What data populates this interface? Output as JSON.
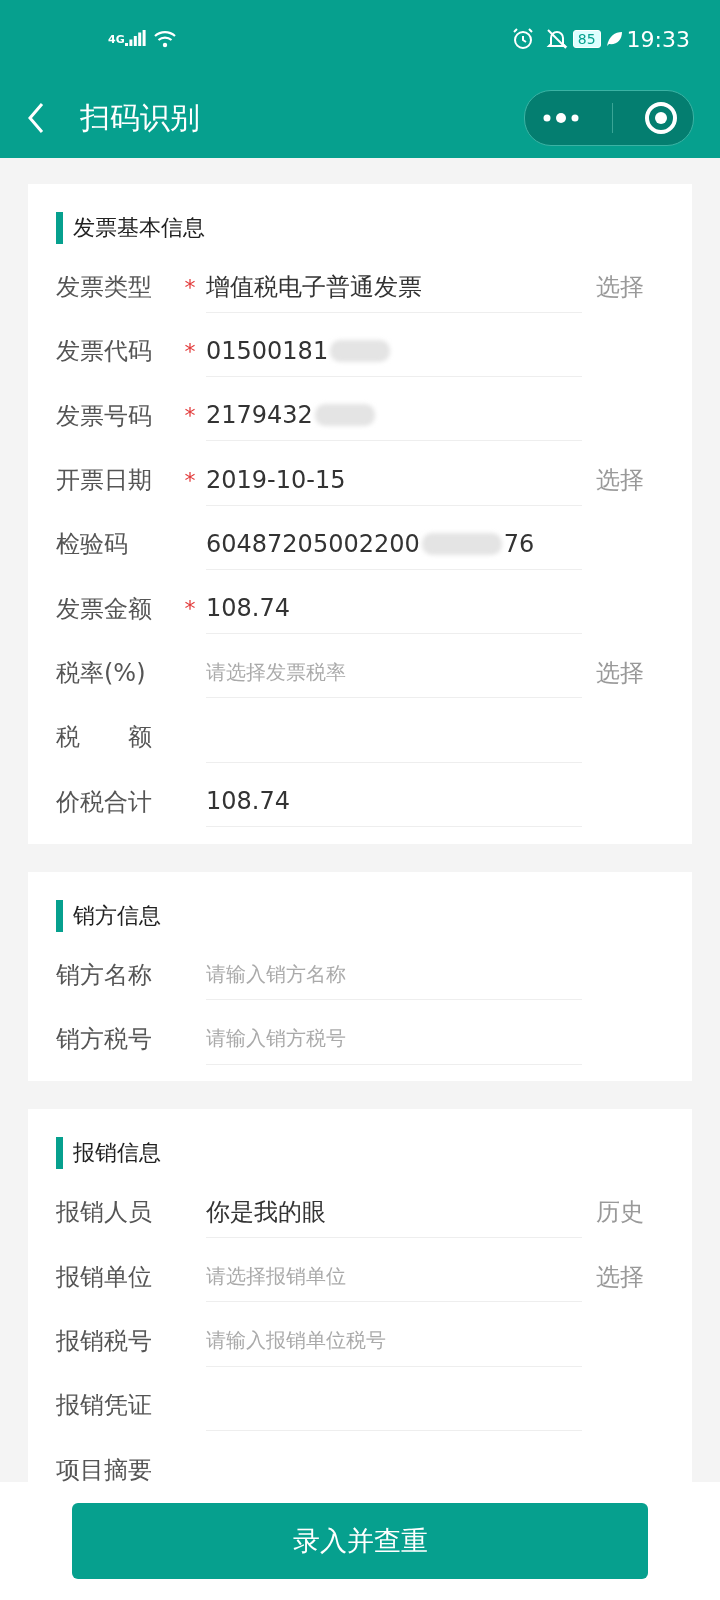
{
  "status_bar": {
    "network": "4G",
    "battery": "85",
    "time": "19:33"
  },
  "header": {
    "title": "扫码识别"
  },
  "sections": [
    {
      "title": "发票基本信息",
      "rows": [
        {
          "label": "发票类型",
          "required_mark": "*",
          "value": "增值税电子普通发票",
          "action": "选择"
        },
        {
          "label": "发票代码",
          "required_mark": "*",
          "value": "01500181",
          "redacted": true
        },
        {
          "label": "发票号码",
          "required_mark": "*",
          "value": "2179432",
          "redacted": true
        },
        {
          "label": "开票日期",
          "required_mark": "*",
          "value": "2019-10-15",
          "action": "选择"
        },
        {
          "label": "检验码",
          "value": "60487205002200",
          "redacted": true,
          "value_end": "76"
        },
        {
          "label": "发票金额",
          "required_mark": "*",
          "value": "108.74"
        },
        {
          "label": "税率(%)",
          "placeholder": "请选择发票税率",
          "action": "选择"
        },
        {
          "label": "税　　额"
        },
        {
          "label": "价税合计",
          "value": "108.74"
        }
      ]
    },
    {
      "title": "销方信息",
      "rows": [
        {
          "label": "销方名称",
          "placeholder": "请输入销方名称"
        },
        {
          "label": "销方税号",
          "placeholder": "请输入销方税号"
        }
      ]
    },
    {
      "title": "报销信息",
      "rows": [
        {
          "label": "报销人员",
          "value": "你是我的眼",
          "action": "历史"
        },
        {
          "label": "报销单位",
          "placeholder": "请选择报销单位",
          "action": "选择"
        },
        {
          "label": "报销税号",
          "placeholder": "请输入报销单位税号"
        },
        {
          "label": "报销凭证"
        },
        {
          "label": "项目摘要"
        }
      ]
    }
  ],
  "submit_button": "录入并查重"
}
